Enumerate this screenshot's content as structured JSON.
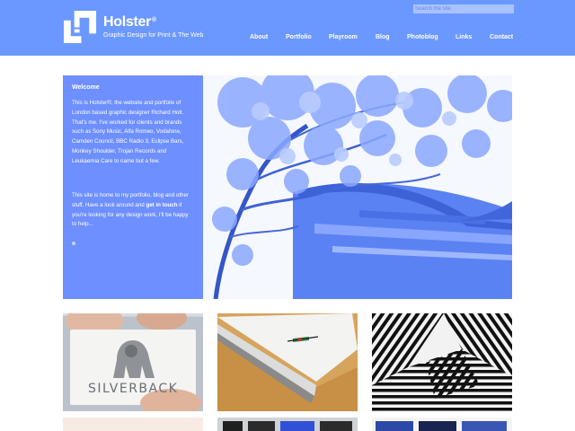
{
  "brand": {
    "name": "Holster",
    "registered_mark": "®",
    "tagline": "Graphic Design for Print & The Web"
  },
  "search": {
    "placeholder": "Search the site",
    "value": ""
  },
  "nav": {
    "items": [
      {
        "label": "About"
      },
      {
        "label": "Portfolio"
      },
      {
        "label": "Playroom"
      },
      {
        "label": "Blog"
      },
      {
        "label": "Photoblog"
      },
      {
        "label": "Links"
      },
      {
        "label": "Contact"
      }
    ]
  },
  "hero": {
    "heading": "Welcome",
    "paragraph1_part1": "This is Holster",
    "paragraph1_mark": "®",
    "paragraph1_part2": ", the website and portfolio of London based graphic designer Richard Holt. That's me. I've worked for clients and brands such as Sony Music, Alfa Romeo, Vodafone, Camden Council, BBC Radio 3, Eclipse Bars, Monkey Shoulder, Trojan Records and Leukaemia Care to name but a few.",
    "paragraph2_part1": "This site is home to my portfolio, blog and other stuff. Have a look around and ",
    "paragraph2_link": "get in touch",
    "paragraph2_part2": " if you're looking for any design work, I'll be happy to help..."
  },
  "portfolio": {
    "silverback_card_text": "SILVERBACK"
  },
  "colors": {
    "header": "#6b98ff",
    "hero_tint": "#6f95ff",
    "white": "#ffffff"
  }
}
